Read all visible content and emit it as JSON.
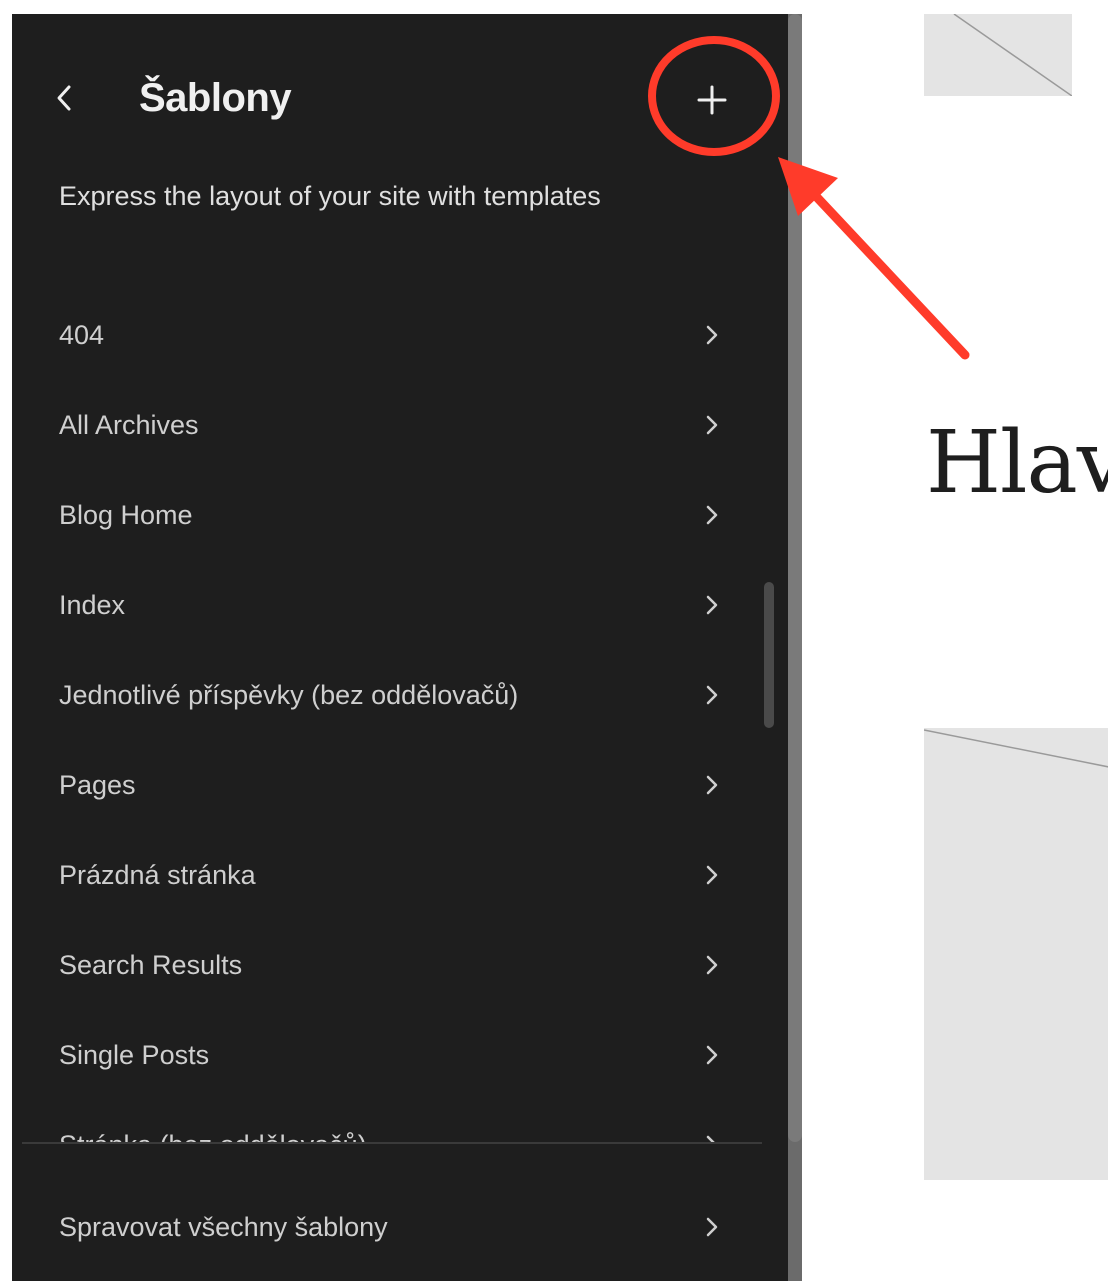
{
  "sidebar": {
    "title": "Šablony",
    "description": "Express the layout of your site with templates",
    "back_icon": "chevron-left-icon",
    "add_icon": "plus-icon",
    "templates": [
      {
        "label": "404"
      },
      {
        "label": "All Archives"
      },
      {
        "label": "Blog Home"
      },
      {
        "label": "Index"
      },
      {
        "label": "Jednotlivé příspěvky (bez oddělovačů)"
      },
      {
        "label": "Pages"
      },
      {
        "label": "Prázdná stránka"
      },
      {
        "label": "Search Results"
      },
      {
        "label": "Single Posts"
      },
      {
        "label": "Stránka (bez oddělovačů)"
      }
    ],
    "footer": {
      "label": "Spravovat všechny šablony"
    }
  },
  "canvas": {
    "heading": "Hlav"
  },
  "colors": {
    "sidebar_bg": "#1e1e1e",
    "annotation": "#ff3b2a",
    "placeholder": "#e4e4e4"
  }
}
